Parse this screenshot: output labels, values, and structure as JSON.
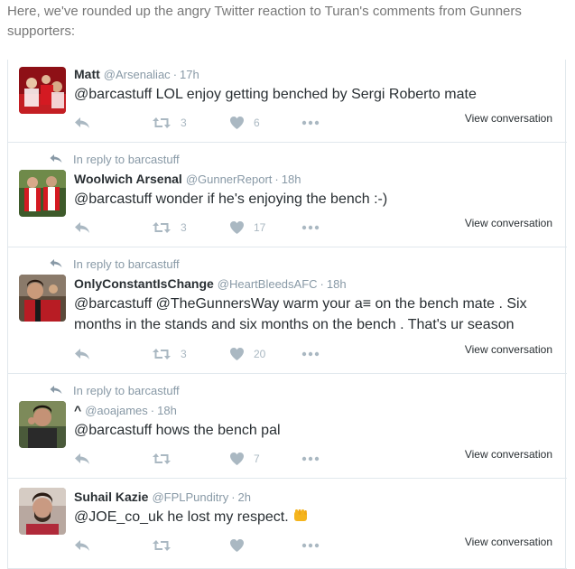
{
  "intro": "Here, we've rounded up the angry Twitter reaction to Turan's comments from Gunners supporters:",
  "reply_prefix": "In reply to",
  "view_conversation": "View conversation",
  "tweets": [
    {
      "name": "Matt",
      "handle": "@Arsenaliac",
      "time": "17h",
      "reply_to": "",
      "text": "@barcastuff LOL enjoy getting benched by Sergi Roberto mate",
      "retweets": "3",
      "likes": "6",
      "avatar_color": "#b3151c"
    },
    {
      "name": "Woolwich Arsenal",
      "handle": "@GunnerReport",
      "time": "18h",
      "reply_to": "barcastuff",
      "text": "@barcastuff wonder if he's enjoying the bench :-)",
      "retweets": "3",
      "likes": "17",
      "avatar_color": "#c41e23"
    },
    {
      "name": "OnlyConstantIsChange",
      "handle": "@HeartBleedsAFC",
      "time": "18h",
      "reply_to": "barcastuff",
      "text": "@barcastuff @TheGunnersWay warm your a≡ on the bench mate . Six months in the stands and six months on the bench . That's ur season",
      "retweets": "3",
      "likes": "20",
      "avatar_color": "#7a5a3a"
    },
    {
      "name": "^",
      "handle": "@aoajames",
      "time": "18h",
      "reply_to": "barcastuff",
      "text": "@barcastuff hows the bench pal",
      "retweets": "",
      "likes": "7",
      "avatar_color": "#5a6a3a"
    },
    {
      "name": "Suhail Kazie",
      "handle": "@FPLPunditry",
      "time": "2h",
      "reply_to": "",
      "text": "@JOE_co_uk he lost my respect.",
      "retweets": "",
      "likes": "",
      "avatar_color": "#9a8a8a"
    }
  ],
  "colors": {
    "text": "#292f33",
    "muted": "#8899a6",
    "icon": "#aab8c2",
    "divider": "#e1e8ed",
    "emoji": "#f5b51e"
  },
  "icons": {
    "reply": "reply-icon",
    "retweet": "retweet-icon",
    "like": "heart-icon",
    "more": "more-icon",
    "reply_context": "reply-context-arrow-icon"
  }
}
